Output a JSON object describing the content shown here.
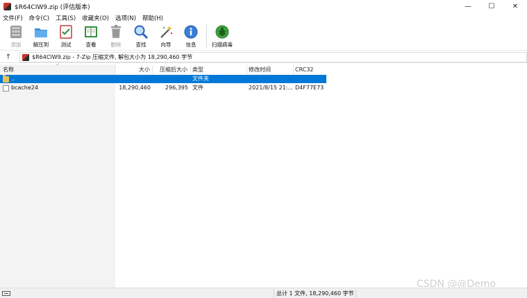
{
  "window": {
    "title": "$R64CIW9.zip (评估版本)",
    "controls": {
      "minimize": "—",
      "maximize": "☐",
      "close": "✕"
    }
  },
  "menu": [
    "文件(F)",
    "命令(C)",
    "工具(S)",
    "收藏夹(O)",
    "选项(N)",
    "帮助(H)"
  ],
  "toolbar": [
    {
      "label": "添加",
      "icon": "add-icon",
      "enabled": false
    },
    {
      "label": "解压到",
      "icon": "extract-folder-icon",
      "enabled": true
    },
    {
      "label": "测试",
      "icon": "test-icon",
      "enabled": true
    },
    {
      "label": "查看",
      "icon": "view-book-icon",
      "enabled": true
    },
    {
      "label": "删除",
      "icon": "delete-trash-icon",
      "enabled": false
    },
    {
      "label": "查找",
      "icon": "find-magnifier-icon",
      "enabled": true
    },
    {
      "label": "向导",
      "icon": "wizard-wand-icon",
      "enabled": true
    },
    {
      "label": "信息",
      "icon": "info-icon",
      "enabled": true
    },
    {
      "label": "扫描病毒",
      "icon": "virus-scan-icon",
      "enabled": true
    }
  ],
  "address": {
    "up_icon": "↑",
    "path": "$R64CIW9.zip - 7-Zip 压缩文件, 解包大小为 18,290,460 字节"
  },
  "columns": {
    "name": "名称",
    "size": "大小",
    "packed": "压缩后大小",
    "type": "类型",
    "modified": "修改时间",
    "crc": "CRC32",
    "sort_caret": "˅"
  },
  "rows": [
    {
      "name": "..",
      "size": "",
      "packed": "",
      "type": "文件夹",
      "modified": "",
      "crc": "",
      "selected": true
    },
    {
      "name": "bcache24",
      "size": "18,290,460",
      "packed": "296,395",
      "type": "文件",
      "modified": "2021/8/15 21:...",
      "crc": "D4F77E73",
      "selected": false
    }
  ],
  "status": {
    "summary": "总计 1 文件, 18,290,460 字节"
  },
  "watermark": "CSDN @@Demo",
  "colors": {
    "selection": "#0078d7",
    "left_pane": "#f3f3f3",
    "statusbar": "#f0f0f0"
  }
}
